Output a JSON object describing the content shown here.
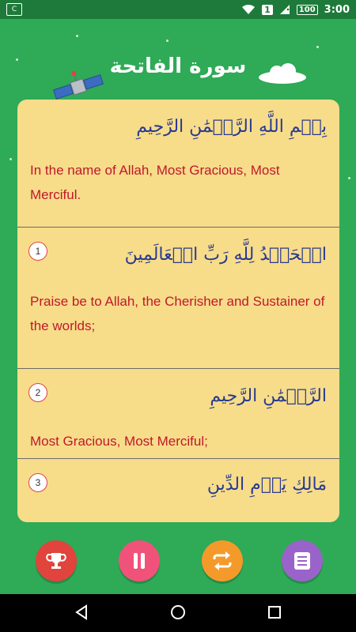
{
  "status_bar": {
    "sim_label": "C",
    "notification_badge": "1",
    "battery": "100",
    "time": "3:00"
  },
  "header": {
    "surah_title": "سورة الفاتحة"
  },
  "verses": [
    {
      "number": "",
      "arabic": "بِسۡمِ اللَّهِ الرَّحۡمَٰنِ الرَّحِيمِ",
      "translation": "In the name of Allah, Most Gracious, Most Merciful."
    },
    {
      "number": "1",
      "arabic": "الۡحَمۡدُ لِلَّهِ رَبِّ الۡعَالَمِينَ",
      "translation": "Praise be to Allah, the Cherisher and Sustainer of the worlds;"
    },
    {
      "number": "2",
      "arabic": "الرَّحۡمَٰنِ الرَّحِيمِ",
      "translation": "Most Gracious, Most Merciful;"
    },
    {
      "number": "3",
      "arabic": "مَالِكِ يَوۡمِ الدِّينِ",
      "translation": ""
    }
  ],
  "controls": [
    {
      "name": "trophy",
      "icon": "trophy-icon",
      "color": "#e0443c"
    },
    {
      "name": "pause",
      "icon": "pause-icon",
      "color": "#f0527a"
    },
    {
      "name": "repeat",
      "icon": "repeat-icon",
      "color": "#f49a2b"
    },
    {
      "name": "list",
      "icon": "list-icon",
      "color": "#9a63c9"
    }
  ],
  "colors": {
    "background": "#2faa57",
    "status_bar": "#1e7a3a",
    "card": "#f7dc8a",
    "arabic_text": "#283a8e",
    "translation_text": "#c0192a"
  }
}
